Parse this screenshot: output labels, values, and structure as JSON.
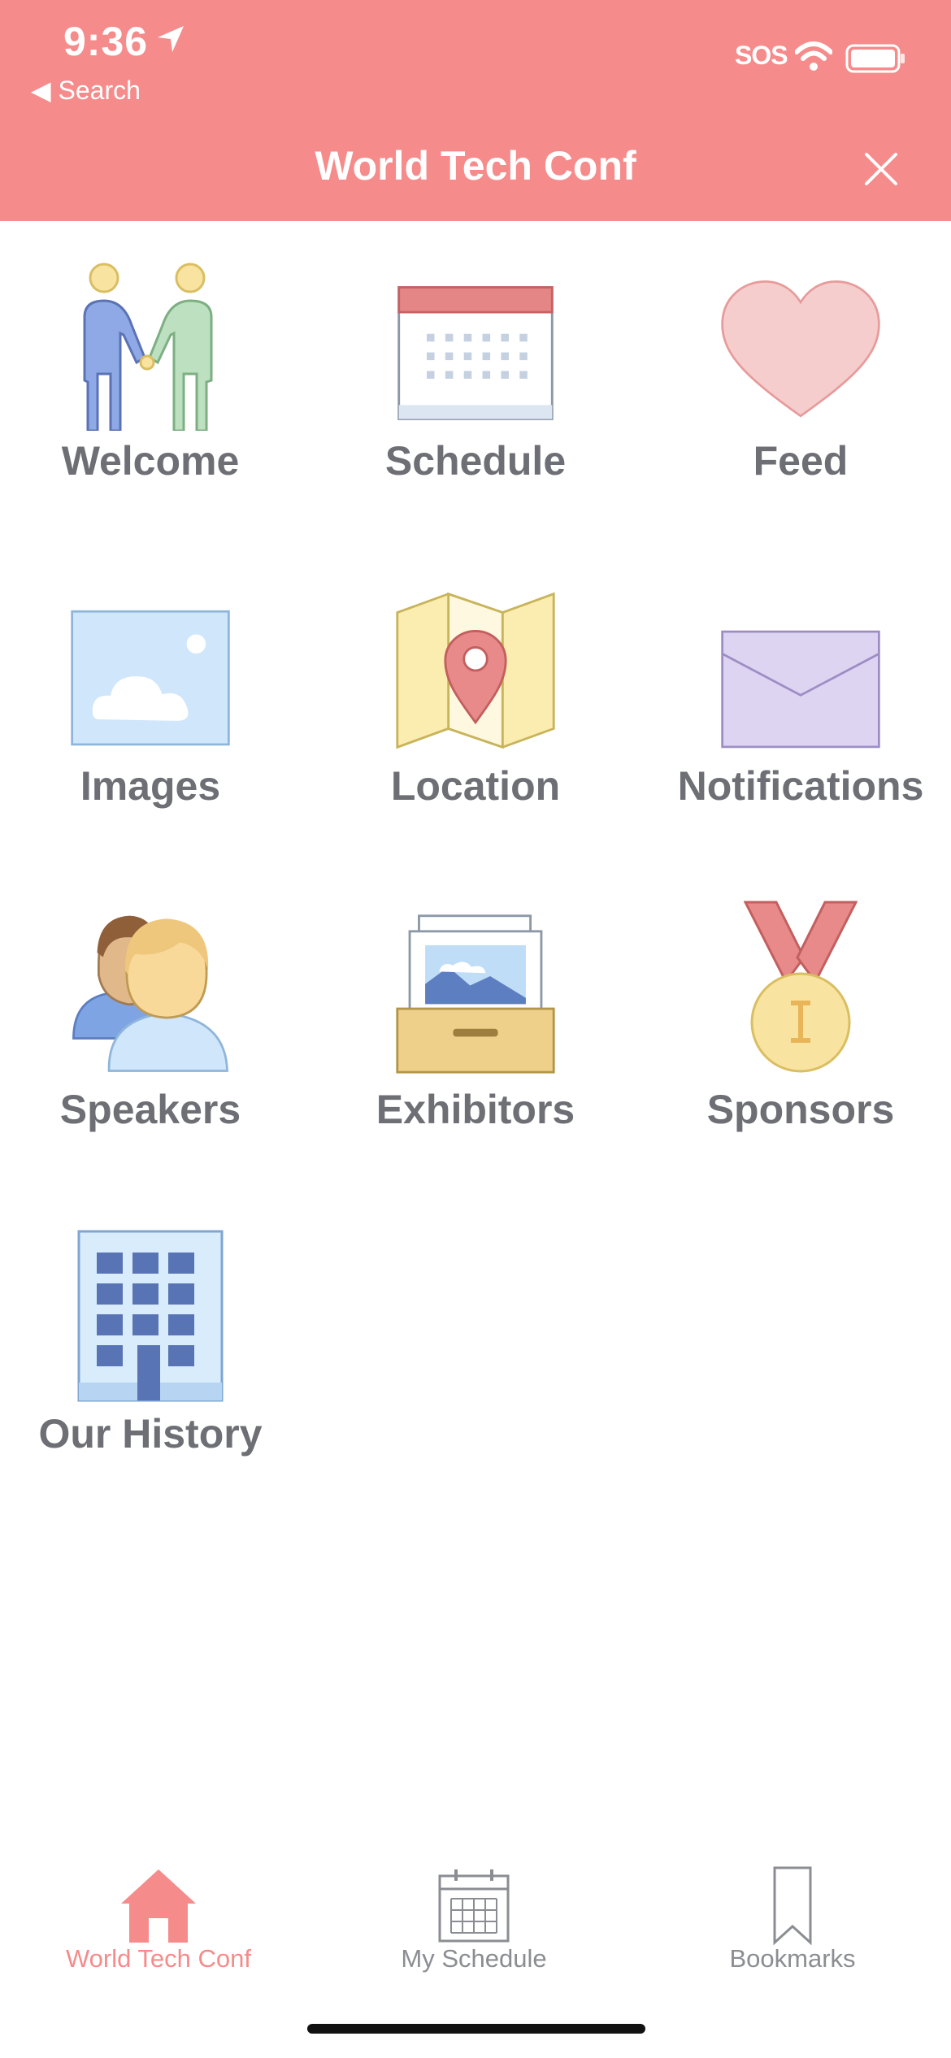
{
  "status_bar": {
    "time": "9:36",
    "back_label": "◀ Search",
    "carrier": "SOS"
  },
  "header": {
    "title": "World Tech Conf"
  },
  "grid": {
    "items": [
      {
        "label": "Welcome",
        "icon": "couple-icon"
      },
      {
        "label": "Schedule",
        "icon": "calendar-icon"
      },
      {
        "label": "Feed",
        "icon": "heart-icon"
      },
      {
        "label": "Images",
        "icon": "image-icon"
      },
      {
        "label": "Location",
        "icon": "map-pin-icon"
      },
      {
        "label": "Notifications",
        "icon": "envelope-icon"
      },
      {
        "label": "Speakers",
        "icon": "people-icon"
      },
      {
        "label": "Exhibitors",
        "icon": "archive-box-icon"
      },
      {
        "label": "Sponsors",
        "icon": "medal-icon"
      },
      {
        "label": "Our History",
        "icon": "building-icon"
      }
    ]
  },
  "tabbar": {
    "tabs": [
      {
        "label": "World Tech Conf",
        "icon": "home-icon",
        "active": true
      },
      {
        "label": "My Schedule",
        "icon": "calendar-grid-icon",
        "active": false
      },
      {
        "label": "Bookmarks",
        "icon": "bookmark-icon",
        "active": false
      }
    ]
  },
  "colors": {
    "accent": "#F68B8B",
    "label_gray": "#6D6F75",
    "tab_gray": "#8B8D92"
  }
}
